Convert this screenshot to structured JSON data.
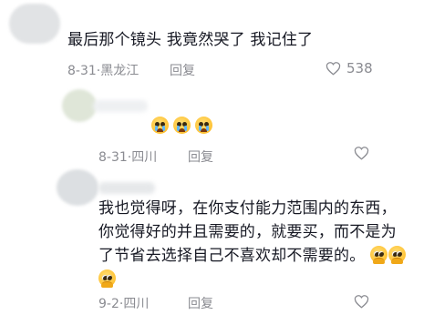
{
  "comments": [
    {
      "text": "最后那个镜头 我竟然哭了 我记住了",
      "date": "8-31",
      "location": "黑龙江",
      "reply_label": "回复",
      "likes": "538"
    },
    {
      "text": "",
      "emoji": [
        "loudly-crying-face",
        "loudly-crying-face",
        "loudly-crying-face"
      ],
      "date": "8-31",
      "location": "四川",
      "reply_label": "回复",
      "likes": ""
    },
    {
      "text": "我也觉得呀，在你支付能力范围内的东西，你觉得好的并且需要的，就要买，而不是为了节省去选择自己不喜欢却不需要的。",
      "emoji": [
        "pleading-face",
        "pleading-face",
        "pleading-face"
      ],
      "date": "9-2",
      "location": "四川",
      "reply_label": "回复",
      "likes": ""
    }
  ],
  "icons": {
    "like": "heart-outline-icon"
  },
  "colors": {
    "text": "#161823",
    "meta": "#8a8b91",
    "background": "#ffffff"
  },
  "separator": "·"
}
